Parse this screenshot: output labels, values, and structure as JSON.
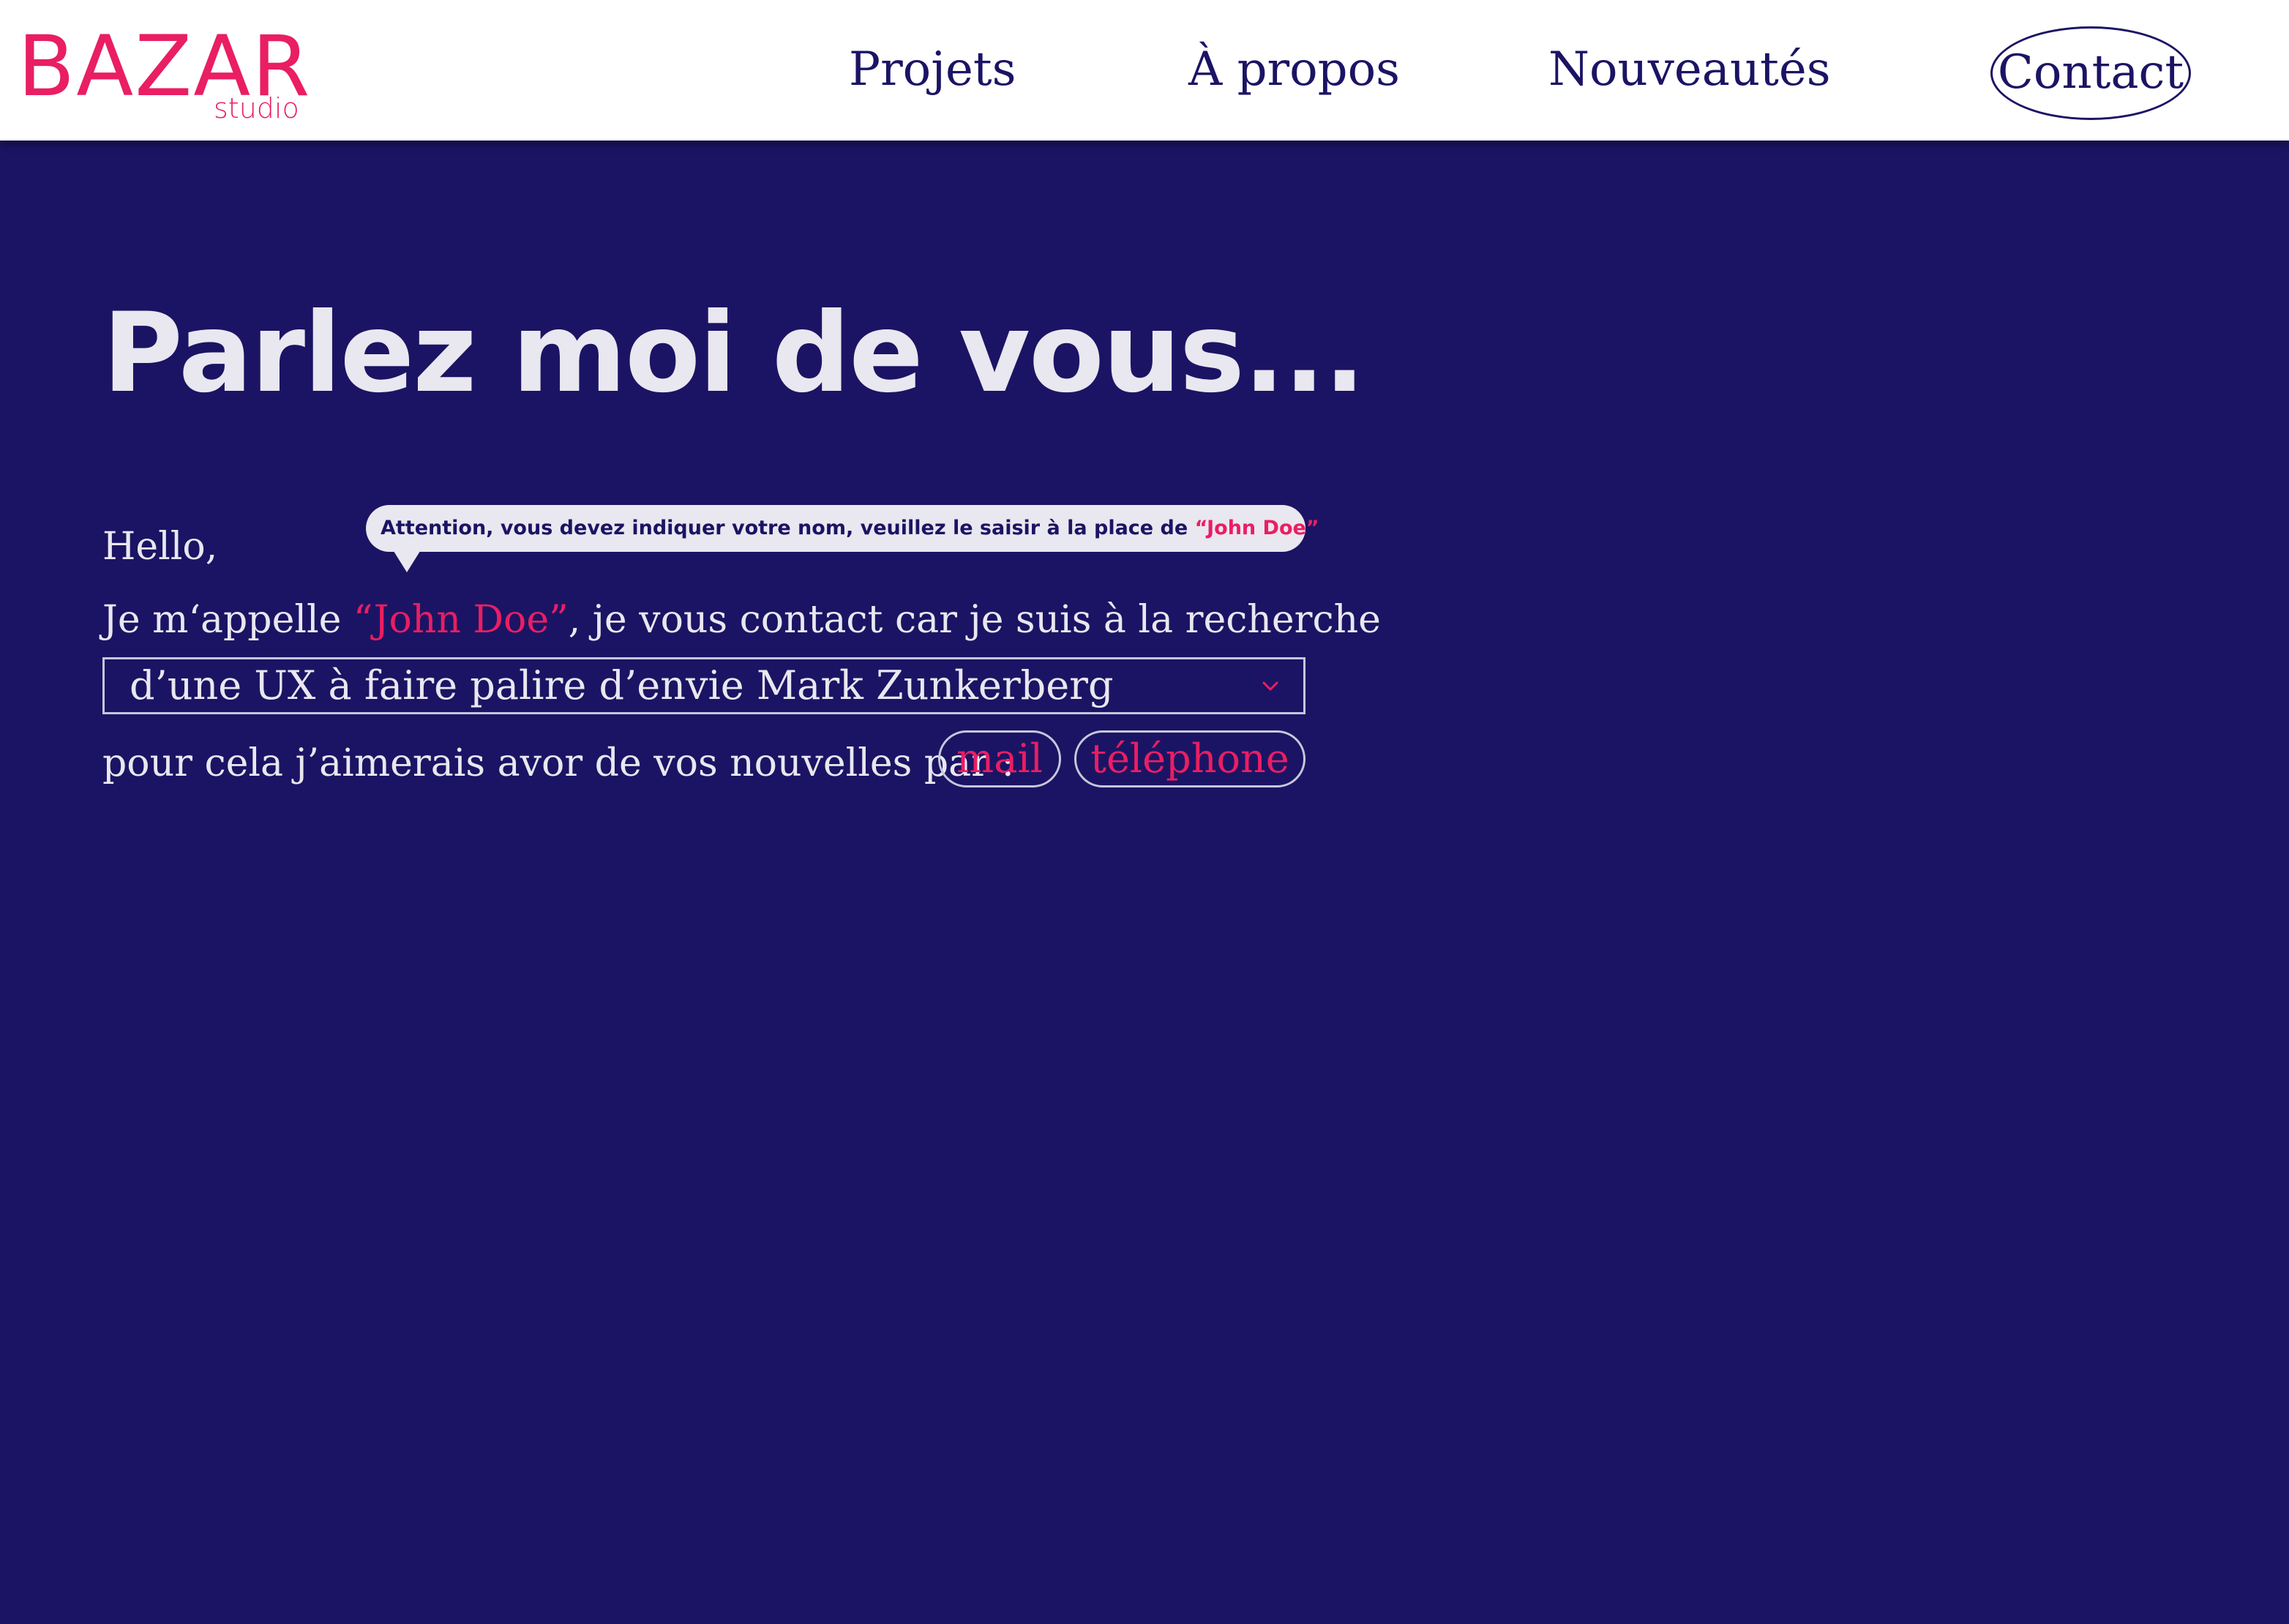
{
  "header": {
    "logo_main": "BAZAR",
    "logo_sub": "studio",
    "nav": {
      "projets": "Projets",
      "apropos": "À propos",
      "nouveautes": "Nouveautés",
      "contact": "Contact"
    }
  },
  "main": {
    "title": "Parlez moi de vous...",
    "greeting": "Hello,",
    "tooltip": {
      "text": "Attention, vous devez indiquer votre nom, veuillez le saisir à la place de ",
      "highlight": "“John Doe”"
    },
    "intro_prefix": "Je m‘appelle ",
    "name_value": "“John Doe”",
    "intro_suffix": ", je vous contact car je suis à la recherche",
    "select_value": "d’une UX à faire palire d’envie Mark Zunkerberg",
    "contact_prompt": "pour cela j’aimerais avor de vos nouvelles par :",
    "option_mail": "mail",
    "option_phone": "téléphone"
  },
  "colors": {
    "background": "#1b1464",
    "accent": "#e91e63",
    "text_light": "#e9e7ef"
  },
  "icons": {
    "select_arrow": "chevron-down-icon"
  }
}
